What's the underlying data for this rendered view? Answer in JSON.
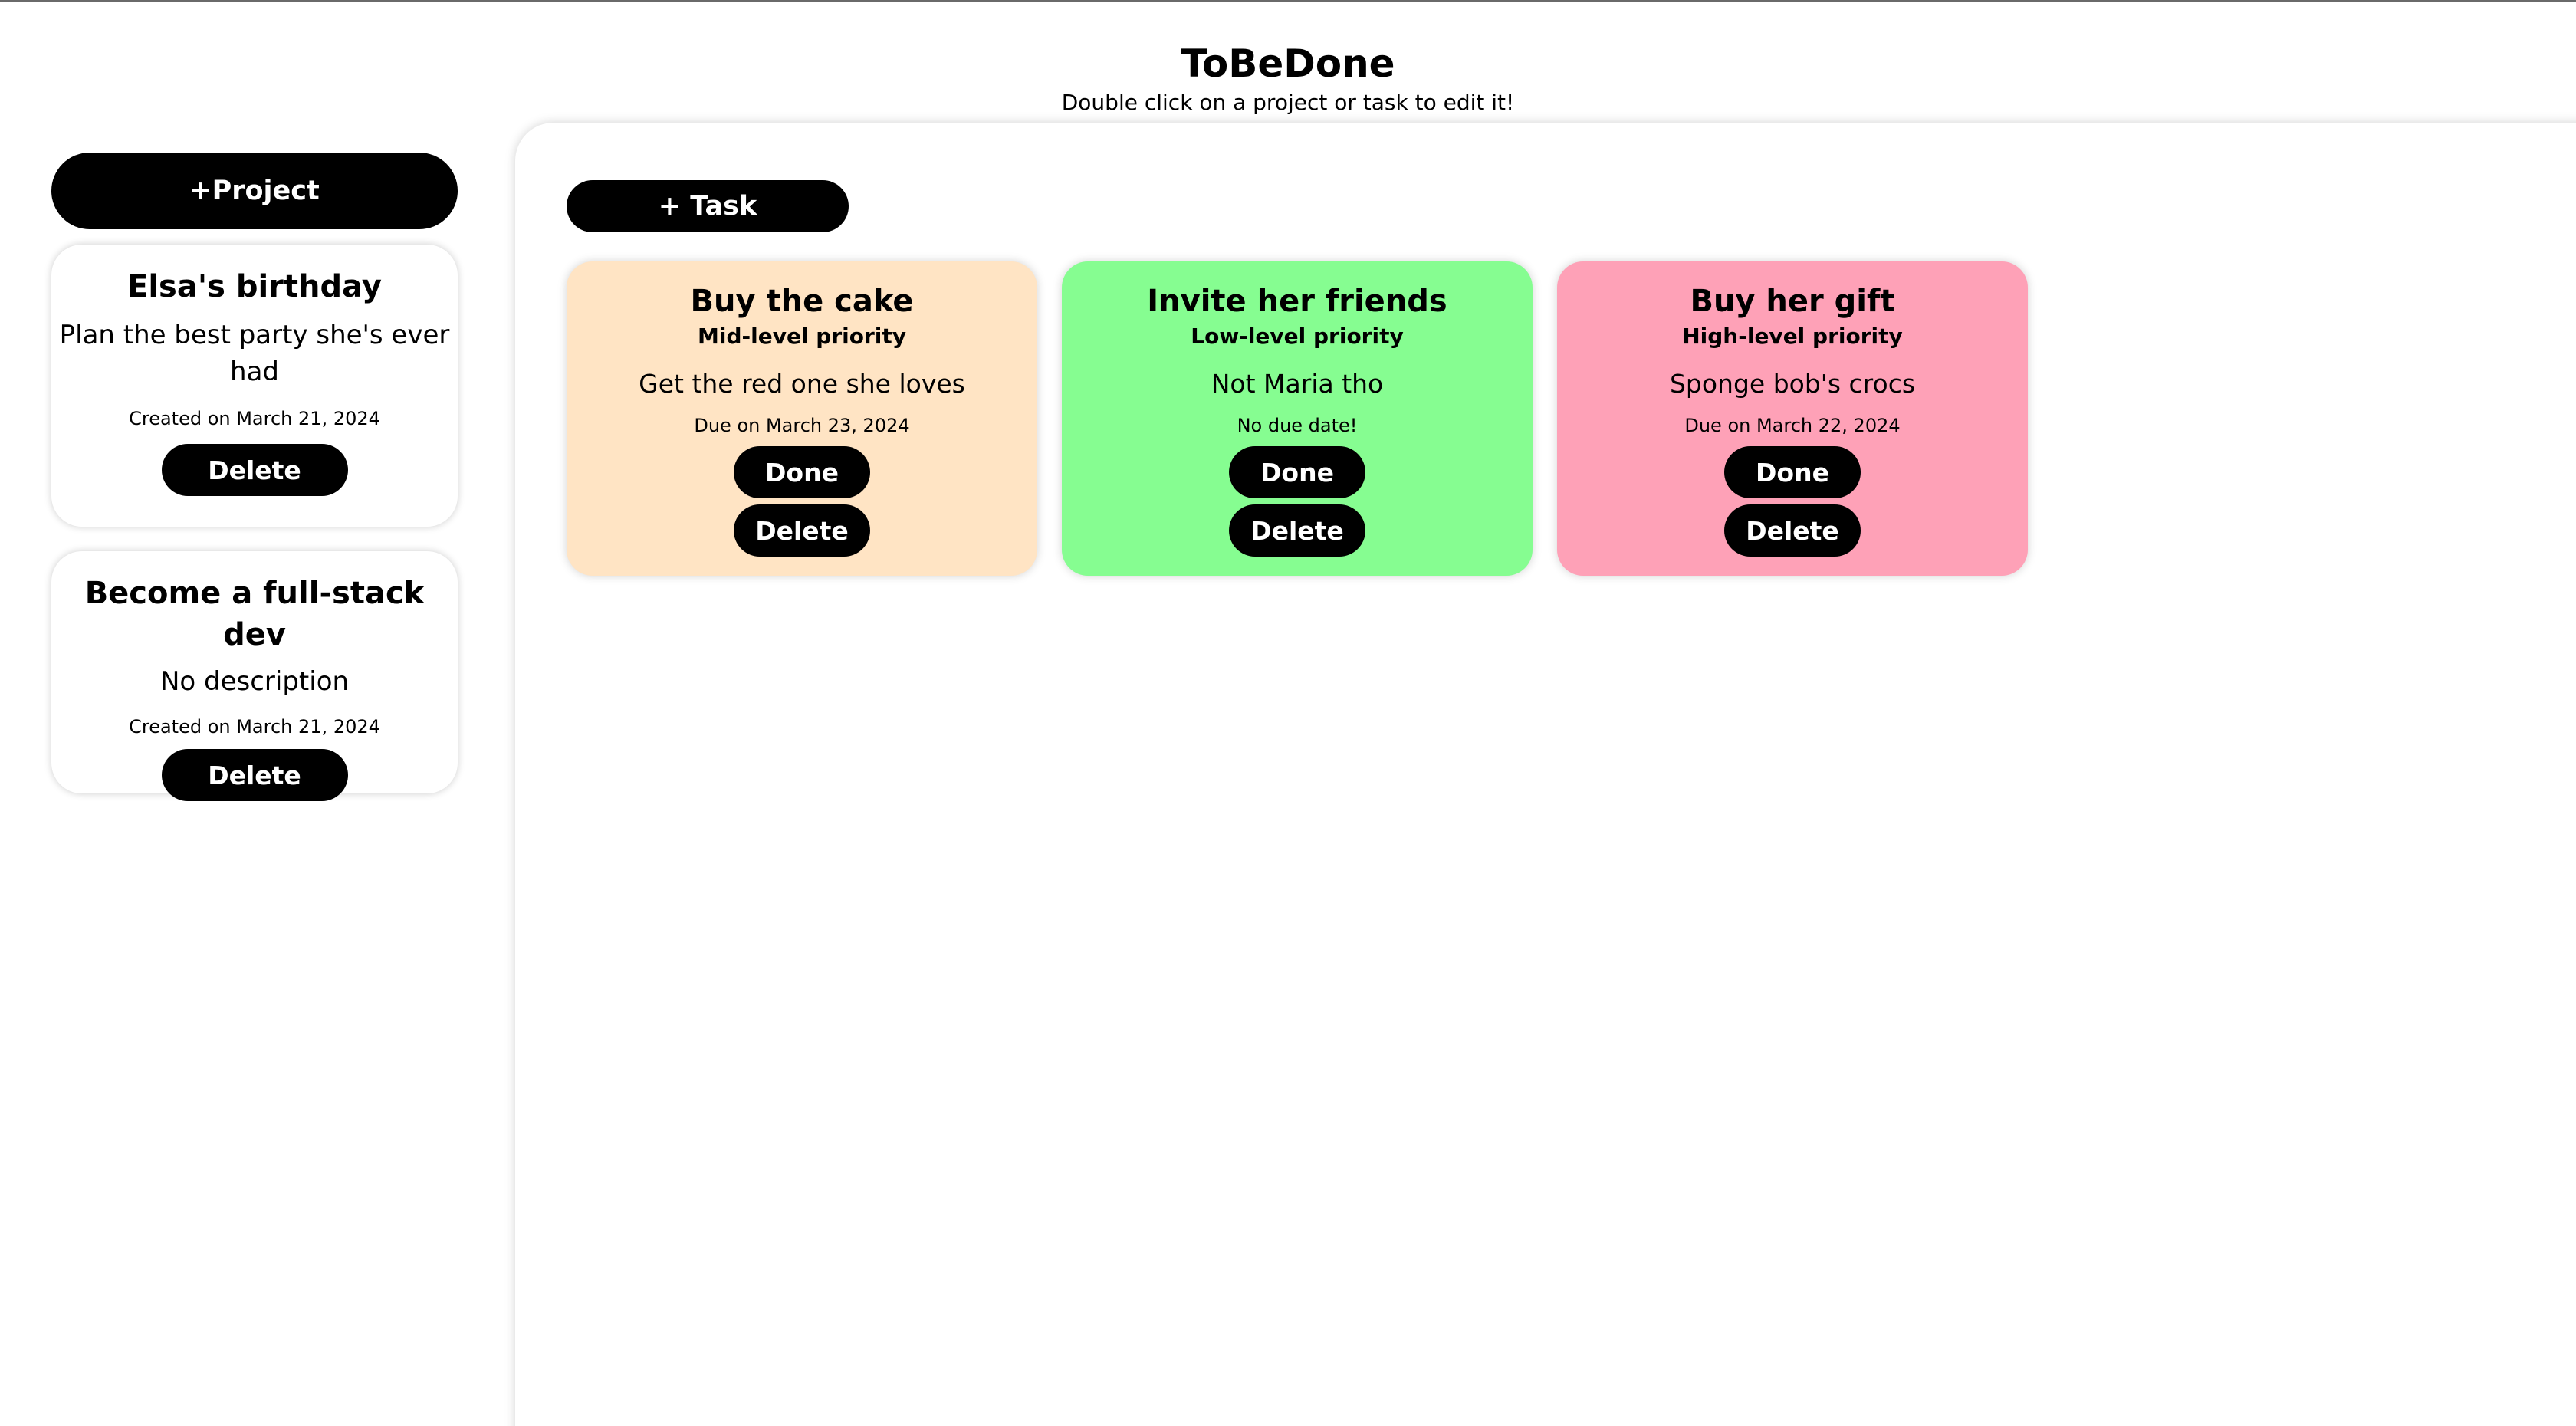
{
  "app": {
    "title": "ToBeDone",
    "subtitle": "Double click on a project or task to edit it!"
  },
  "sidebar": {
    "add_project_label": "+Project",
    "projects": [
      {
        "title": "Elsa's birthday",
        "description": "Plan the best party she's ever had",
        "created": "Created on March 21, 2024",
        "delete_label": "Delete"
      },
      {
        "title": "Become a full-stack dev",
        "description": "No description",
        "created": "Created on March 21, 2024",
        "delete_label": "Delete"
      }
    ]
  },
  "main": {
    "add_task_label": "+ Task",
    "tasks": [
      {
        "title": "Buy the cake",
        "priority": "Mid-level priority",
        "description": "Get the red one she loves",
        "due": "Due on March 23, 2024",
        "done_label": "Done",
        "delete_label": "Delete",
        "color": "#ffe4c4"
      },
      {
        "title": "Invite her friends",
        "priority": "Low-level priority",
        "description": "Not Maria tho",
        "due": "No due date!",
        "done_label": "Done",
        "delete_label": "Delete",
        "color": "#86fd91"
      },
      {
        "title": "Buy her gift",
        "priority": "High-level priority",
        "description": "Sponge bob's crocs",
        "due": "Due on March 22, 2024",
        "done_label": "Done",
        "delete_label": "Delete",
        "color": "#fea1b7"
      }
    ]
  }
}
